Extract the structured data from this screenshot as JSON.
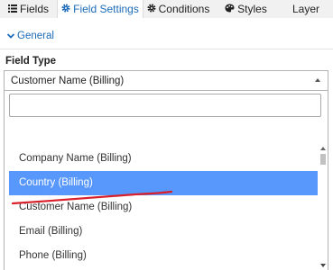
{
  "tabs": [
    {
      "label": "Fields",
      "icon": "list-icon"
    },
    {
      "label": "Field Settings",
      "icon": "gear-icon",
      "active": true
    },
    {
      "label": "Conditions",
      "icon": "gear-icon"
    },
    {
      "label": "Styles",
      "icon": "palette-icon"
    },
    {
      "label": "Layer",
      "icon": ""
    }
  ],
  "section": {
    "label": "General",
    "icon": "chevron-down-icon"
  },
  "field_type": {
    "label": "Field Type",
    "selected": "Customer Name (Billing)",
    "search_value": "",
    "options": [
      "",
      "Company Name (Billing)",
      "Country (Billing)",
      "Customer Name (Billing)",
      "Email (Billing)",
      "Phone (Billing)"
    ],
    "highlighted": "Country (Billing)",
    "underlined": "Customer Name (Billing)"
  },
  "colors": {
    "accent": "#1b6bb8",
    "highlight": "#5897fb",
    "annotation": "#d9202a"
  }
}
